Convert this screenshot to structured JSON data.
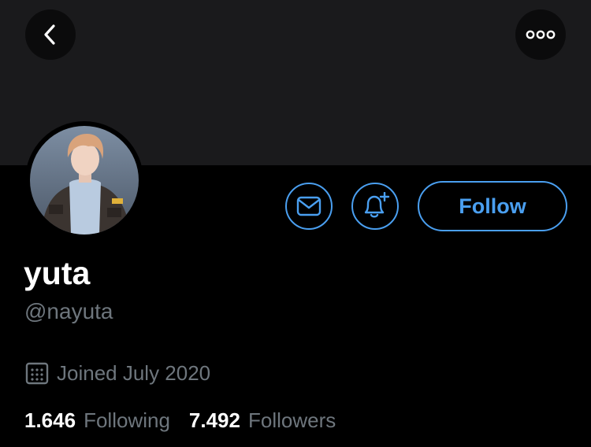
{
  "profile": {
    "display_name": "yuta",
    "handle": "@nayuta",
    "joined": "Joined July 2020",
    "following_count": "1.646",
    "following_label": "Following",
    "followers_count": "7.492",
    "followers_label": "Followers"
  },
  "actions": {
    "follow_label": "Follow"
  },
  "icons": {
    "back": "chevron-left-icon",
    "more": "more-horizontal-icon",
    "message": "envelope-icon",
    "notification": "bell-plus-icon",
    "calendar": "calendar-icon"
  },
  "colors": {
    "accent": "#4a9ff0",
    "background": "#000000",
    "banner": "#1a1a1c",
    "secondary_text": "#6e767d"
  }
}
